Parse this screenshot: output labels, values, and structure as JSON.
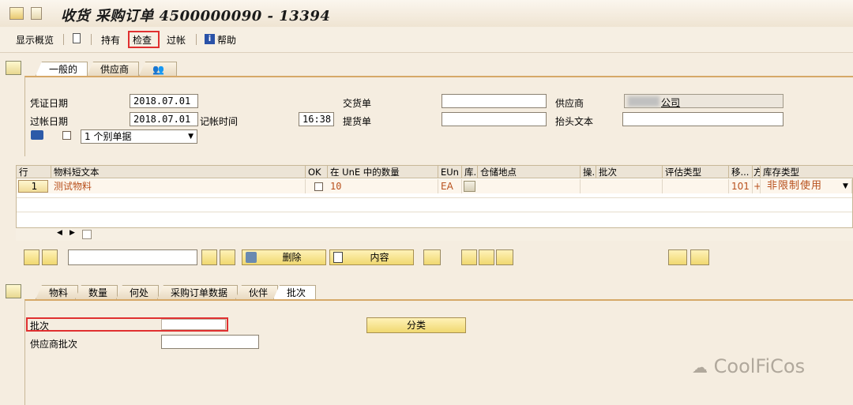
{
  "title": "收货 采购订单 4500000090 - 13394",
  "toolbar": {
    "items": [
      "显示概览",
      "持有",
      "检查",
      "过帐",
      "帮助"
    ]
  },
  "header_tabs": [
    "一般的",
    "供应商"
  ],
  "header": {
    "doc_date_label": "凭证日期",
    "doc_date": "2018.07.01",
    "post_date_label": "过帐日期",
    "post_date": "2018.07.01",
    "record_time_label": "记帐时间",
    "record_time": "16:38",
    "delivery_note_label": "交货单",
    "bill_lading_label": "提货单",
    "vendor_label": "供应商",
    "vendor_value": "公司",
    "header_text_label": "抬头文本",
    "slip_select": "1 个别单据"
  },
  "table": {
    "headers": [
      "行",
      "物料短文本",
      "OK",
      "在 UnE 中的数量",
      "EUn",
      "库.",
      "仓储地点",
      "操.",
      "批次",
      "评估类型",
      "移...",
      "方",
      "库存类型"
    ],
    "rows": [
      {
        "line": "1",
        "material": "测试物料",
        "qty": "10",
        "unit": "EA",
        "movement": "101",
        "sign": "+",
        "stock_type": "非限制使用"
      }
    ]
  },
  "item_buttons": {
    "delete": "删除",
    "content": "内容"
  },
  "detail_tabs": [
    "物料",
    "数量",
    "何处",
    "采购订单数据",
    "伙伴",
    "批次"
  ],
  "detail": {
    "batch_label": "批次",
    "vendor_batch_label": "供应商批次",
    "classify_button": "分类"
  },
  "watermark": "CoolFiCos"
}
